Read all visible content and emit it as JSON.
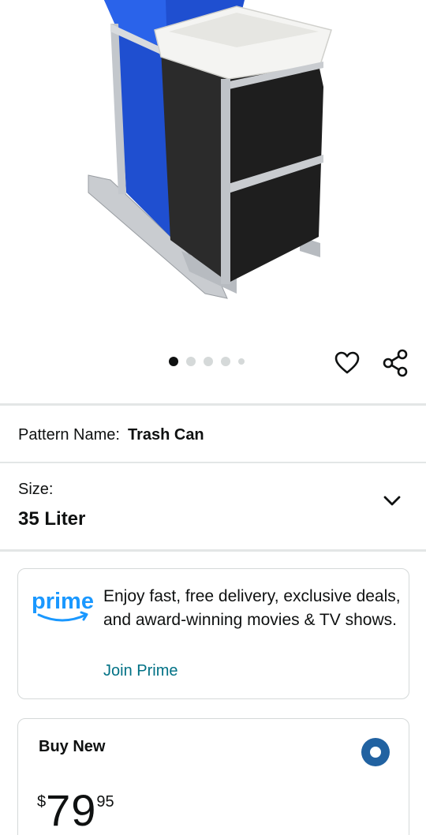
{
  "carousel": {
    "count": 5,
    "active_index": 0
  },
  "icons": {
    "favorite": "heart-icon",
    "share": "share-icon",
    "size_dropdown": "chevron-down-icon"
  },
  "pattern": {
    "label": "Pattern Name:",
    "value": "Trash Can"
  },
  "size": {
    "label": "Size:",
    "value": "35 Liter"
  },
  "prime": {
    "logo_text": "prime",
    "description": "Enjoy fast, free delivery, exclusive deals, and award-winning movies & TV shows.",
    "link_label": "Join Prime"
  },
  "buy": {
    "title": "Buy New",
    "price_symbol": "$",
    "price_whole": "79",
    "price_fraction": "95",
    "selected": true
  },
  "colors": {
    "accent": "#2162a1",
    "link": "#007185",
    "prime_blue": "#1a98ff",
    "bin_blue": "#1f4fd0",
    "bin_black": "#1e1e1e"
  }
}
